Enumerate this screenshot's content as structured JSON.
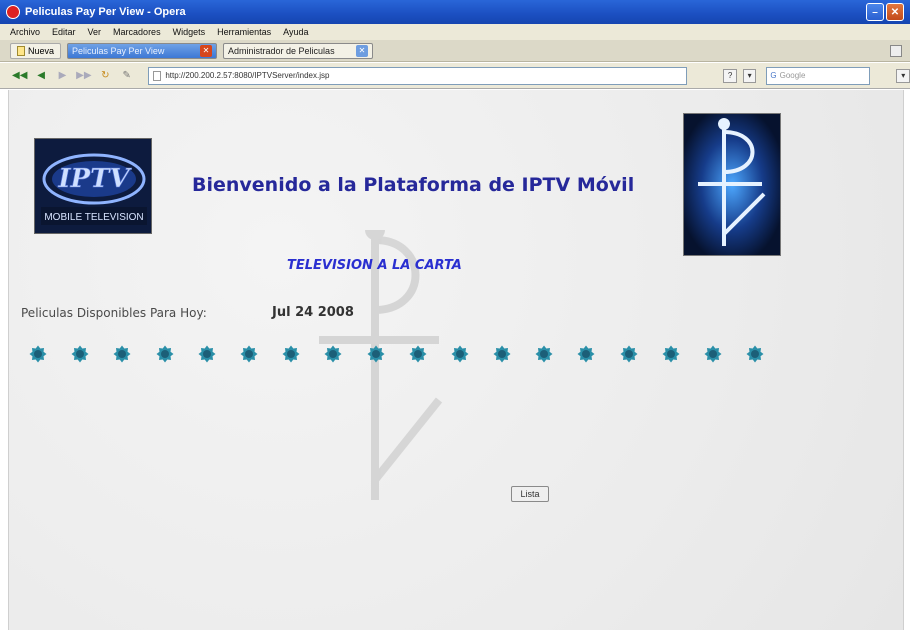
{
  "window": {
    "title": "Peliculas Pay Per View - Opera"
  },
  "menu": {
    "items": [
      "Archivo",
      "Editar",
      "Ver",
      "Marcadores",
      "Widgets",
      "Herramientas",
      "Ayuda"
    ]
  },
  "tabs": {
    "new_label": "Nueva",
    "items": [
      {
        "label": "Peliculas Pay Per View",
        "active": true
      },
      {
        "label": "Administrador de Peliculas",
        "active": false
      }
    ]
  },
  "address": {
    "url": "http://200.200.2.57:8080/IPTVServer/index.jsp",
    "search_placeholder": "Google"
  },
  "page": {
    "welcome": "Bienvenido a la Plataforma de IPTV Móvil",
    "subtitle": "TELEVISION A LA CARTA",
    "available_label": "Peliculas Disponibles Para Hoy:",
    "date": "Jul 24 2008",
    "star_count": 18,
    "list_button": "Lista",
    "logo_left_text": "IPTV",
    "logo_left_caption": "MOBILE TELEVISION"
  },
  "colors": {
    "heading": "#26289a",
    "subtitle": "#2a2fd0",
    "star": "#2a8fa8"
  }
}
